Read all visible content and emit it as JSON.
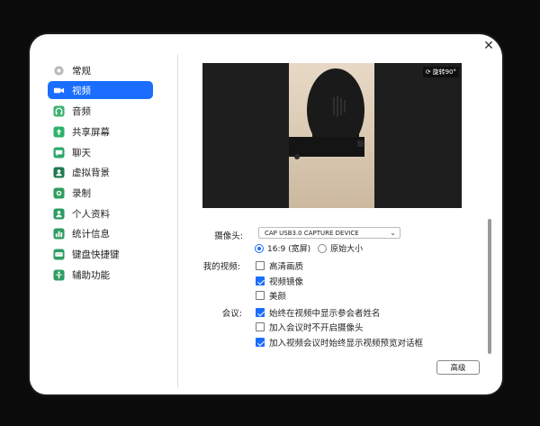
{
  "dialog": {
    "close_icon": "close-icon"
  },
  "sidebar": {
    "items": [
      {
        "label": "常规",
        "icon": "gear-icon",
        "active": false
      },
      {
        "label": "视频",
        "icon": "video-camera-icon",
        "active": true
      },
      {
        "label": "音频",
        "icon": "headphones-icon",
        "active": false
      },
      {
        "label": "共享屏幕",
        "icon": "share-screen-icon",
        "active": false
      },
      {
        "label": "聊天",
        "icon": "chat-icon",
        "active": false
      },
      {
        "label": "虚拟背景",
        "icon": "person-background-icon",
        "active": false
      },
      {
        "label": "录制",
        "icon": "record-icon",
        "active": false
      },
      {
        "label": "个人资料",
        "icon": "profile-icon",
        "active": false
      },
      {
        "label": "统计信息",
        "icon": "statistics-icon",
        "active": false
      },
      {
        "label": "键盘快捷键",
        "icon": "keyboard-icon",
        "active": false
      },
      {
        "label": "辅助功能",
        "icon": "accessibility-icon",
        "active": false
      }
    ],
    "accent": "#1a6dff"
  },
  "preview": {
    "rotate_label": "旋转90°"
  },
  "camera": {
    "label": "摄像头:",
    "selected": "CAP USB3.0 CAPTURE DEVICE",
    "ratio_options": [
      {
        "label": "16:9 (宽屏)",
        "selected": true
      },
      {
        "label": "原始大小",
        "selected": false
      }
    ]
  },
  "my_video": {
    "label": "我的视频:",
    "options": [
      {
        "label": "高清画质",
        "checked": false
      },
      {
        "label": "视频镜像",
        "checked": true
      },
      {
        "label": "美颜",
        "checked": false
      }
    ]
  },
  "meeting": {
    "label": "会议:",
    "options": [
      {
        "label": "始终在视频中显示参会者姓名",
        "checked": true
      },
      {
        "label": "加入会议时不开启摄像头",
        "checked": false
      },
      {
        "label": "加入视频会议时始终显示视频预览对话框",
        "checked": true
      }
    ]
  },
  "footer": {
    "advanced_label": "高级"
  }
}
